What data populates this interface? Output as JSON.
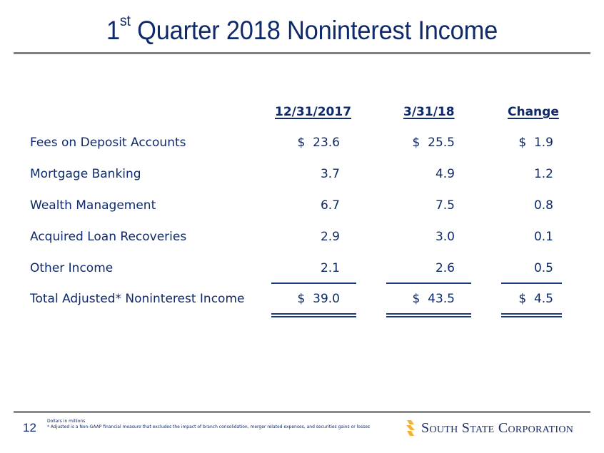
{
  "slide": {
    "title_prefix": "1",
    "title_sup": "st",
    "title_rest": " Quarter 2018 Noninterest Income",
    "page_number": "12"
  },
  "table": {
    "headers": [
      "12/31/2017",
      "3/31/18",
      "Change"
    ],
    "rows": [
      {
        "label": "Fees on Deposit Accounts",
        "v1": "$  23.6",
        "v2": "$  25.5",
        "v3": "$  1.9"
      },
      {
        "label": "Mortgage Banking",
        "v1": "3.7",
        "v2": "4.9",
        "v3": "1.2"
      },
      {
        "label": "Wealth Management",
        "v1": "6.7",
        "v2": "7.5",
        "v3": "0.8"
      },
      {
        "label": "Acquired Loan Recoveries",
        "v1": "2.9",
        "v2": "3.0",
        "v3": "0.1"
      },
      {
        "label": "Other Income",
        "v1": "2.1",
        "v2": "2.6",
        "v3": "0.5"
      }
    ],
    "total": {
      "label": "Total Adjusted* Noninterest Income",
      "v1": "$  39.0",
      "v2": "$  43.5",
      "v3": "$  4.5"
    }
  },
  "footer": {
    "note1": "Dollars in millions",
    "note2": "* Adjusted is a Non-GAAP financial measure that excludes the impact of branch consolidation, merger related expenses, and securities gains or losses",
    "logo_text": "South State Corporation",
    "logo_icon": "stacked-s-icon",
    "logo_color": "#f5b335"
  },
  "colors": {
    "text": "#0f2a6b",
    "rule": "#7f7f7f"
  }
}
